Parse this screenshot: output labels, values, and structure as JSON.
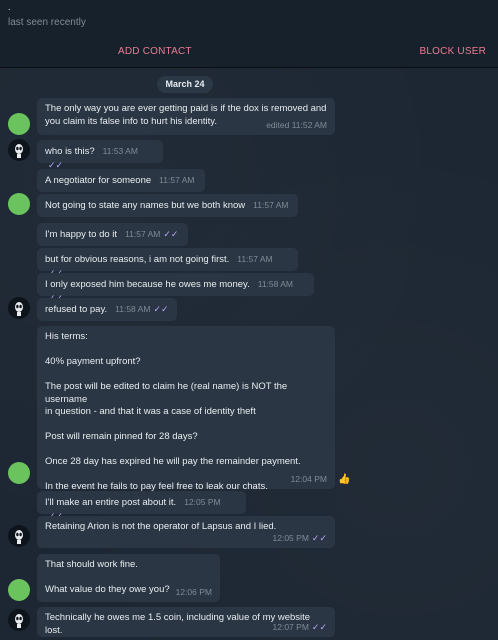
{
  "header": {
    "name": ".",
    "status": "last seen recently",
    "add_contact": "ADD CONTACT",
    "block_user": "BLOCK USER"
  },
  "chat": {
    "date": "March 24",
    "messages": [
      {
        "text": "The only way you are ever getting paid is if the dox is removed and\nyou claim its false info to hurt his identity.",
        "time": "edited 11:52 AM"
      },
      {
        "text": "who is this?",
        "time": "11:53 AM"
      },
      {
        "text": "A negotiator for someone",
        "time": "11:57 AM"
      },
      {
        "text": "Not going to state any names but we both know",
        "time": "11:57 AM"
      },
      {
        "text": "I'm happy to do it",
        "time": "11:57 AM"
      },
      {
        "text": "but for obvious reasons, i am not going first.",
        "time": "11:57 AM"
      },
      {
        "text": "I only exposed him because he owes me money.",
        "time": "11:58 AM"
      },
      {
        "text": "refused to pay.",
        "time": "11:58 AM"
      },
      {
        "text": "His terms:\n\n40% payment upfront?\n\nThe post will be edited to claim he (real name) is NOT the username\nin question - and that it was a case of identity theft\n\nPost will remain pinned for 28 days?\n\nOnce 28 day has expired he will pay the remainder payment.\n\nIn the event he fails to pay feel free to leak our chats.",
        "time": "12:04 PM",
        "reaction": "👍"
      },
      {
        "text": "I'll make an entire post about it.",
        "time": "12:05 PM"
      },
      {
        "text": "Retaining Arion is not the operator of Lapsus and I lied.",
        "time": "12:05 PM"
      },
      {
        "text": "That should work fine.\n\nWhat value do they owe you?",
        "time": "12:06 PM"
      },
      {
        "text": "Technically he owes me 1.5 coin, including value of my website lost.",
        "time": "12:07 PM"
      }
    ]
  },
  "colors": {
    "accent": "#ea7b91",
    "bubble": "#2a3643",
    "background": "#1d2733",
    "read_ticks": "#b7a7ff",
    "avatar_green": "#6bc35e"
  },
  "icons": {
    "read_receipt": "double-check-icon",
    "dark_avatar": "alien-avatar-icon"
  }
}
